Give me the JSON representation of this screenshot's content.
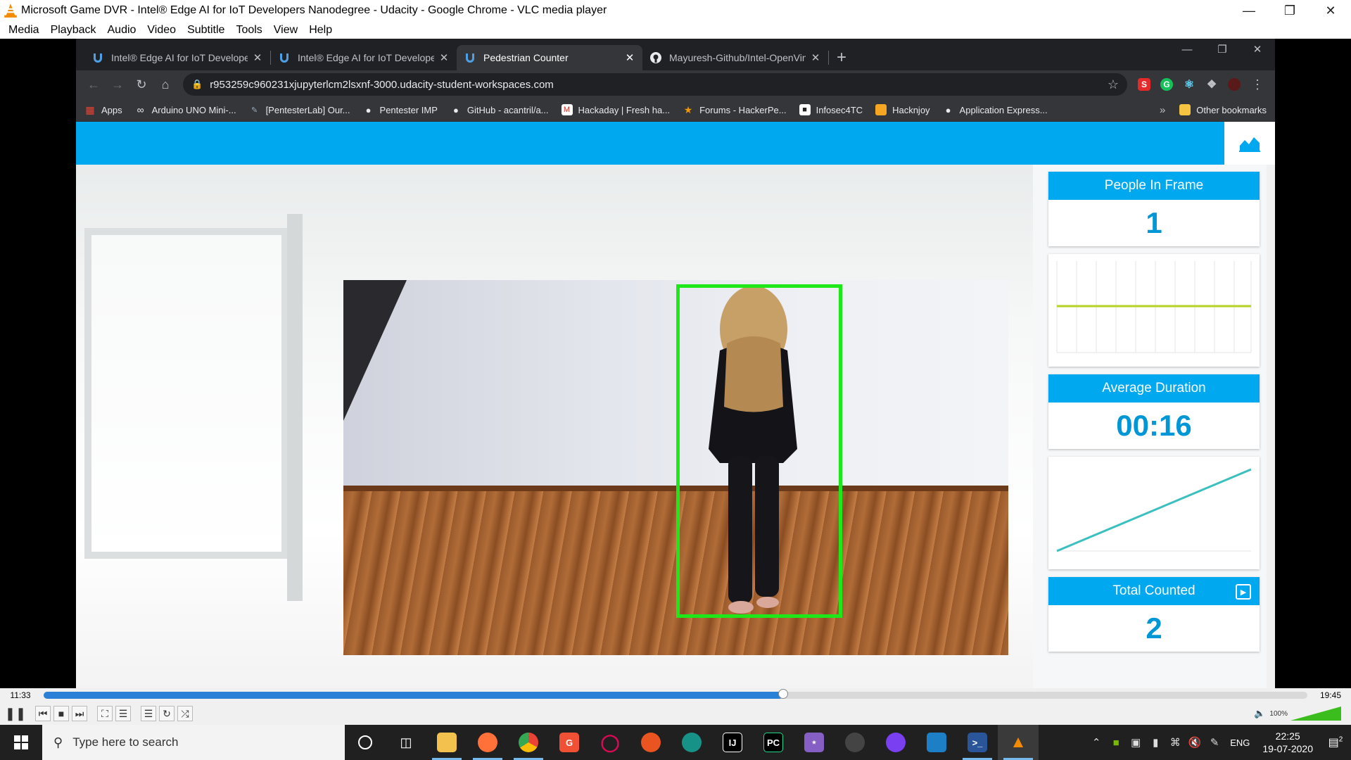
{
  "vlc": {
    "title": "Microsoft Game DVR - Intel® Edge AI for IoT Developers Nanodegree - Udacity - Google Chrome - VLC media player",
    "menu": [
      "Media",
      "Playback",
      "Audio",
      "Video",
      "Subtitle",
      "Tools",
      "View",
      "Help"
    ],
    "time_elapsed": "11:33",
    "time_total": "19:45",
    "progress": 0.585,
    "volume": "100%"
  },
  "chrome": {
    "tabs": [
      {
        "label": "Intel® Edge AI for IoT Developer",
        "active": false
      },
      {
        "label": "Intel® Edge AI for IoT Developer",
        "active": false
      },
      {
        "label": "Pedestrian Counter",
        "active": true
      },
      {
        "label": "Mayuresh-Github/Intel-OpenVin",
        "active": false
      }
    ],
    "url": "r953259c960231xjupyterlcm2lsxnf-3000.udacity-student-workspaces.com",
    "bookmarks": [
      "Apps",
      "Arduino UNO Mini-...",
      "[PentesterLab] Our...",
      "Pentester IMP",
      "GitHub - acantril/a...",
      "Hackaday | Fresh ha...",
      "Forums - HackerPe...",
      "Infosec4TC",
      "Hacknjoy",
      "Application Express..."
    ],
    "other_bookmarks": "Other bookmarks"
  },
  "dashboard": {
    "people_in_frame_label": "People In Frame",
    "people_in_frame": "1",
    "average_duration_label": "Average Duration",
    "average_duration": "00:16",
    "total_counted_label": "Total Counted",
    "total_counted": "2"
  },
  "taskbar": {
    "search_placeholder": "Type here to search",
    "language": "ENG",
    "time": "22:25",
    "date": "19-07-2020",
    "notifications": "2"
  },
  "colors": {
    "accent": "#00a8ef",
    "value_blue": "#0196d6",
    "bbox_green": "#1ee81a"
  }
}
